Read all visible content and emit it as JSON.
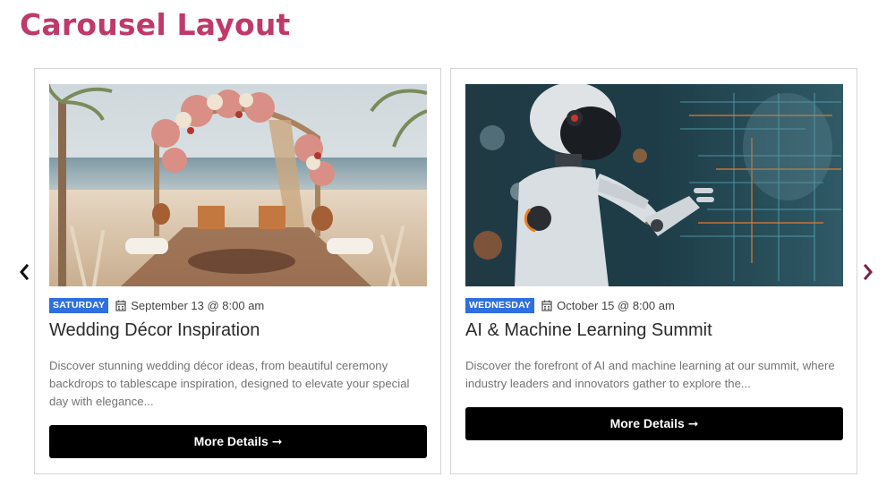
{
  "page": {
    "title": "Carousel Layout"
  },
  "carousel": {
    "prev_icon": "chevron-left-icon",
    "next_icon": "chevron-right-icon",
    "cards": [
      {
        "day": "SATURDAY",
        "date": "September 13 @ 8:00 am",
        "title": "Wedding Décor Inspiration",
        "description": "Discover stunning wedding décor ideas, from beautiful ceremony backdrops to tablescape inspiration, designed to elevate your special day with elegance...",
        "button": "More Details ➞",
        "image": "beach wedding arch photo"
      },
      {
        "day": "WEDNESDAY",
        "date": "October 15 @ 8:00 am",
        "title": "AI & Machine Learning Summit",
        "description": "Discover the forefront of AI and machine learning at our summit, where industry leaders and innovators gather to explore the...",
        "button": "More Details ➞",
        "image": "robot touching digital interface photo"
      }
    ]
  },
  "colors": {
    "title": "#c0396b",
    "badge": "#2f6fe0",
    "button": "#000000",
    "next_arrow": "#7a1f4f"
  }
}
